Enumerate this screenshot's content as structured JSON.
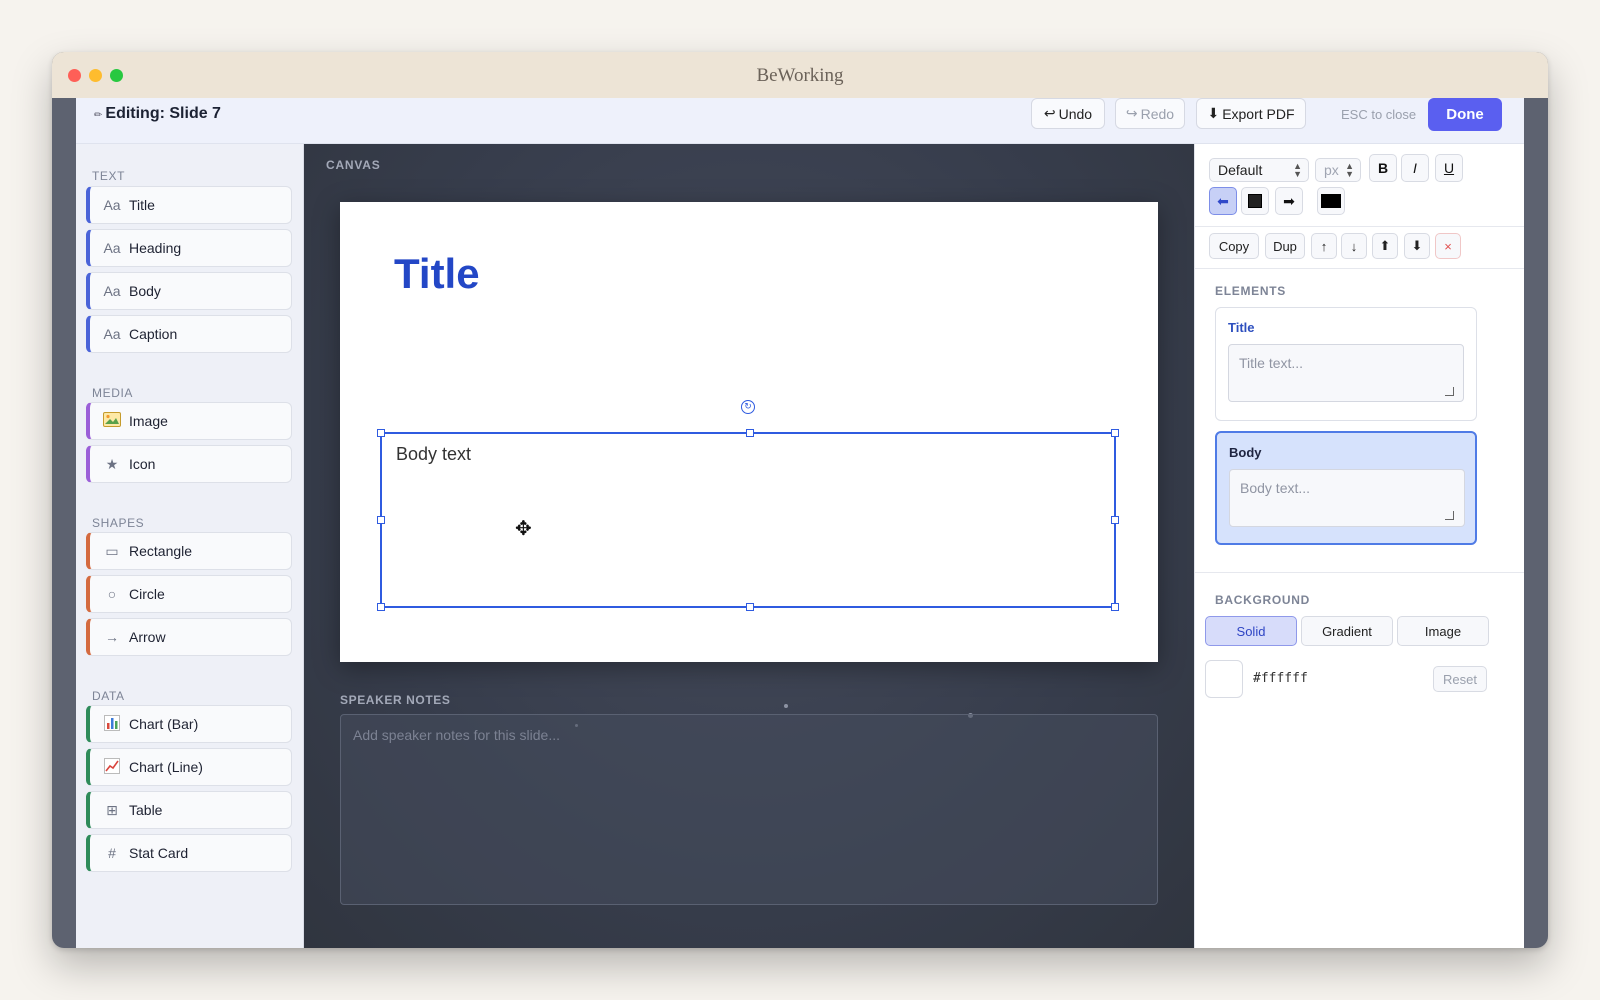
{
  "window": {
    "title": "BeWorking"
  },
  "topbar": {
    "editing_title": "Editing: Slide 7",
    "undo": "Undo",
    "redo": "Redo",
    "export_pdf": "Export PDF",
    "esc_hint": "ESC to close",
    "done": "Done"
  },
  "palette": {
    "sections": {
      "text": "TEXT",
      "media": "MEDIA",
      "shapes": "SHAPES",
      "data": "DATA"
    },
    "text_items": [
      {
        "icon": "Aa",
        "label": "Title"
      },
      {
        "icon": "Aa",
        "label": "Heading"
      },
      {
        "icon": "Aa",
        "label": "Body"
      },
      {
        "icon": "Aa",
        "label": "Caption"
      }
    ],
    "media_items": [
      {
        "icon": "image-icon",
        "label": "Image"
      },
      {
        "icon": "star-icon",
        "label": "Icon"
      }
    ],
    "shape_items": [
      {
        "icon": "rectangle-icon",
        "label": "Rectangle"
      },
      {
        "icon": "circle-icon",
        "label": "Circle"
      },
      {
        "icon": "arrow-icon",
        "label": "Arrow"
      }
    ],
    "data_items": [
      {
        "icon": "bar-chart-icon",
        "label": "Chart (Bar)"
      },
      {
        "icon": "line-chart-icon",
        "label": "Chart (Line)"
      },
      {
        "icon": "table-icon",
        "label": "Table"
      },
      {
        "icon": "hash-icon",
        "label": "Stat Card"
      }
    ]
  },
  "canvas": {
    "label": "CANVAS",
    "slide": {
      "title": "Title",
      "body": "Body text",
      "background": "#ffffff"
    },
    "notes_label": "SPEAKER NOTES",
    "notes_placeholder": "Add speaker notes for this slide..."
  },
  "format": {
    "font": "Default",
    "size_placeholder": "px",
    "bold": "B",
    "italic": "I",
    "underline": "U",
    "align_selected": "left",
    "text_color": "#000000",
    "copy": "Copy",
    "dup": "Dup"
  },
  "elements": {
    "label": "ELEMENTS",
    "items": [
      {
        "name": "Title",
        "placeholder": "Title text...",
        "active": false
      },
      {
        "name": "Body",
        "placeholder": "Body text...",
        "active": true
      }
    ]
  },
  "background": {
    "label": "BACKGROUND",
    "tabs": [
      "Solid",
      "Gradient",
      "Image"
    ],
    "active_tab": "Solid",
    "hex": "#ffffff",
    "reset": "Reset"
  },
  "colors": {
    "accent": "#5a5ff0",
    "title_blue": "#2347c6",
    "selection": "#2f5be0"
  }
}
